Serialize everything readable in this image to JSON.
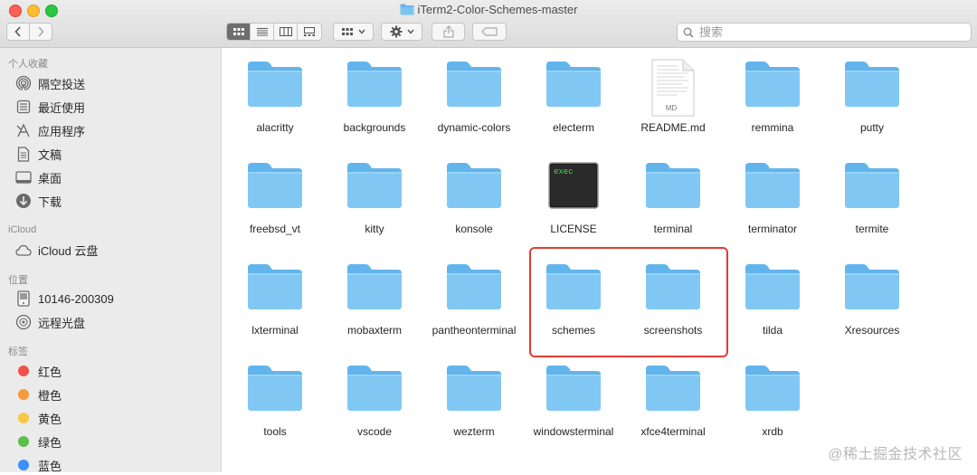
{
  "window": {
    "title": "iTerm2-Color-Schemes-master"
  },
  "toolbar": {
    "back_label": "<",
    "forward_label": ">",
    "search_placeholder": "搜索"
  },
  "sidebar": {
    "favorites_title": "个人收藏",
    "favorites": [
      {
        "label": "隔空投送",
        "icon": "airdrop-icon"
      },
      {
        "label": "最近使用",
        "icon": "recents-icon"
      },
      {
        "label": "应用程序",
        "icon": "applications-icon"
      },
      {
        "label": "文稿",
        "icon": "documents-icon"
      },
      {
        "label": "桌面",
        "icon": "desktop-icon"
      },
      {
        "label": "下载",
        "icon": "downloads-icon"
      }
    ],
    "icloud_title": "iCloud",
    "icloud": [
      {
        "label": "iCloud 云盘",
        "icon": "cloud-icon"
      }
    ],
    "locations_title": "位置",
    "locations": [
      {
        "label": "10146-200309",
        "icon": "disk-icon"
      },
      {
        "label": "远程光盘",
        "icon": "optical-disc-icon"
      }
    ],
    "tags_title": "标签",
    "tags": [
      {
        "label": "红色",
        "color": "#f0504a"
      },
      {
        "label": "橙色",
        "color": "#f79a3b"
      },
      {
        "label": "黄色",
        "color": "#f6c844"
      },
      {
        "label": "绿色",
        "color": "#5dbf4b"
      },
      {
        "label": "蓝色",
        "color": "#3b8ff5"
      }
    ]
  },
  "files": [
    {
      "name": "alacritty",
      "type": "folder"
    },
    {
      "name": "backgrounds",
      "type": "folder"
    },
    {
      "name": "dynamic-colors",
      "type": "folder"
    },
    {
      "name": "electerm",
      "type": "folder"
    },
    {
      "name": "README.md",
      "type": "document",
      "badge": "MD"
    },
    {
      "name": "remmina",
      "type": "folder"
    },
    {
      "name": "putty",
      "type": "folder"
    },
    {
      "name": "freebsd_vt",
      "type": "folder"
    },
    {
      "name": "kitty",
      "type": "folder"
    },
    {
      "name": "konsole",
      "type": "folder"
    },
    {
      "name": "LICENSE",
      "type": "executable",
      "badge": "exec"
    },
    {
      "name": "terminal",
      "type": "folder"
    },
    {
      "name": "terminator",
      "type": "folder"
    },
    {
      "name": "termite",
      "type": "folder"
    },
    {
      "name": "lxterminal",
      "type": "folder"
    },
    {
      "name": "mobaxterm",
      "type": "folder"
    },
    {
      "name": "pantheonterminal",
      "type": "folder"
    },
    {
      "name": "schemes",
      "type": "folder"
    },
    {
      "name": "screenshots",
      "type": "folder"
    },
    {
      "name": "tilda",
      "type": "folder"
    },
    {
      "name": "Xresources",
      "type": "folder"
    },
    {
      "name": "tools",
      "type": "folder"
    },
    {
      "name": "vscode",
      "type": "folder"
    },
    {
      "name": "wezterm",
      "type": "folder"
    },
    {
      "name": "windowsterminal",
      "type": "folder"
    },
    {
      "name": "xfce4terminal",
      "type": "folder"
    },
    {
      "name": "xrdb",
      "type": "folder"
    }
  ],
  "watermark": "@稀土掘金技术社区",
  "colors": {
    "folder": "#7cc4f0",
    "highlight": "#e23b34"
  }
}
